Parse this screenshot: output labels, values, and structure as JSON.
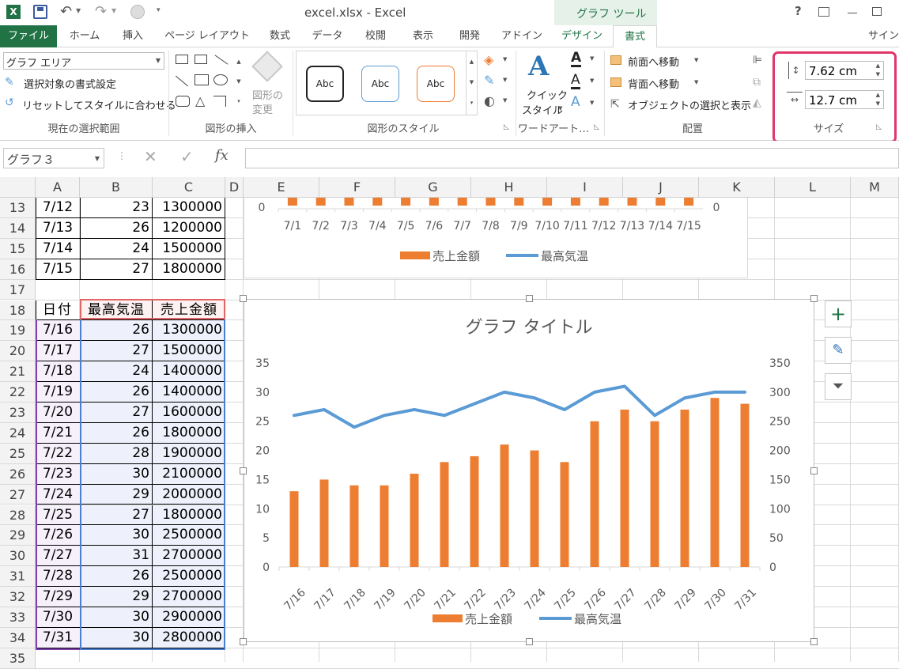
{
  "title_bar": {
    "doc_title": "excel.xlsx - Excel",
    "context_tool": "グラフ ツール",
    "help": "?",
    "colors": {
      "excel_green": "#217346",
      "accent_red": "#e0366a"
    }
  },
  "tabs": {
    "file": "ファイル",
    "home": "ホーム",
    "insert": "挿入",
    "layout": "ページ レイアウト",
    "formulas": "数式",
    "data": "データ",
    "review": "校閲",
    "view": "表示",
    "developer": "開発",
    "addins": "アドイン",
    "design": "デザイン",
    "format": "書式",
    "signin": "サイン"
  },
  "ribbon": {
    "selection": {
      "dropdown_value": "グラフ エリア",
      "format_selection": "選択対象の書式設定",
      "reset_style": "リセットしてスタイルに合わせる",
      "label": "現在の選択範囲"
    },
    "insert_shapes": {
      "change_shape_1": "図形の",
      "change_shape_2": "変更",
      "label": "図形の挿入"
    },
    "shape_styles": {
      "abc": "Abc",
      "label": "図形のスタイル"
    },
    "wordart": {
      "quick_1": "クイック",
      "quick_2": "スタイル",
      "label": "ワードアート…"
    },
    "arrange": {
      "bring_forward": "前面へ移動",
      "send_backward": "背面へ移動",
      "selection_pane": "オブジェクトの選択と表示",
      "label": "配置"
    },
    "size": {
      "height": "7.62 cm",
      "width": "12.7 cm",
      "label": "サイズ"
    }
  },
  "formula_bar": {
    "name_box": "グラフ３",
    "fx": "fx"
  },
  "columns": [
    "A",
    "B",
    "C",
    "D",
    "E",
    "F",
    "G",
    "H",
    "I",
    "J",
    "K",
    "L",
    "M"
  ],
  "rows": [
    {
      "n": "13",
      "a": "7/12",
      "b": "23",
      "c": "1300000"
    },
    {
      "n": "14",
      "a": "7/13",
      "b": "26",
      "c": "1200000"
    },
    {
      "n": "15",
      "a": "7/14",
      "b": "24",
      "c": "1500000"
    },
    {
      "n": "16",
      "a": "7/15",
      "b": "27",
      "c": "1800000"
    },
    {
      "n": "17",
      "a": "",
      "b": "",
      "c": ""
    },
    {
      "n": "18",
      "a": "日付",
      "b": "最高気温",
      "c": "売上金額"
    },
    {
      "n": "19",
      "a": "7/16",
      "b": "26",
      "c": "1300000"
    },
    {
      "n": "20",
      "a": "7/17",
      "b": "27",
      "c": "1500000"
    },
    {
      "n": "21",
      "a": "7/18",
      "b": "24",
      "c": "1400000"
    },
    {
      "n": "22",
      "a": "7/19",
      "b": "26",
      "c": "1400000"
    },
    {
      "n": "23",
      "a": "7/20",
      "b": "27",
      "c": "1600000"
    },
    {
      "n": "24",
      "a": "7/21",
      "b": "26",
      "c": "1800000"
    },
    {
      "n": "25",
      "a": "7/22",
      "b": "28",
      "c": "1900000"
    },
    {
      "n": "26",
      "a": "7/23",
      "b": "30",
      "c": "2100000"
    },
    {
      "n": "27",
      "a": "7/24",
      "b": "29",
      "c": "2000000"
    },
    {
      "n": "28",
      "a": "7/25",
      "b": "27",
      "c": "1800000"
    },
    {
      "n": "29",
      "a": "7/26",
      "b": "30",
      "c": "2500000"
    },
    {
      "n": "30",
      "a": "7/27",
      "b": "31",
      "c": "2700000"
    },
    {
      "n": "31",
      "a": "7/28",
      "b": "26",
      "c": "2500000"
    },
    {
      "n": "32",
      "a": "7/29",
      "b": "29",
      "c": "2700000"
    },
    {
      "n": "33",
      "a": "7/30",
      "b": "30",
      "c": "2900000"
    },
    {
      "n": "34",
      "a": "7/31",
      "b": "30",
      "c": "2800000"
    },
    {
      "n": "35",
      "a": "",
      "b": "",
      "c": ""
    }
  ],
  "chart_data": [
    {
      "type": "bar",
      "categories": [
        "7/1",
        "7/2",
        "7/3",
        "7/4",
        "7/5",
        "7/6",
        "7/7",
        "7/8",
        "7/9",
        "7/10",
        "7/11",
        "7/12",
        "7/13",
        "7/14",
        "7/15"
      ],
      "visible_tick_left": "0",
      "visible_tick_right": "0",
      "legend": [
        "売上金額",
        "最高気温"
      ],
      "colors": {
        "bar": "#ed7d31",
        "line": "#5b9bd5"
      }
    },
    {
      "type": "bar",
      "title": "グラフ タイトル",
      "categories": [
        "7/16",
        "7/17",
        "7/18",
        "7/19",
        "7/20",
        "7/21",
        "7/22",
        "7/23",
        "7/24",
        "7/25",
        "7/26",
        "7/27",
        "7/28",
        "7/29",
        "7/30",
        "7/31"
      ],
      "series": [
        {
          "name": "売上金額",
          "type": "bar",
          "axis": "left",
          "values": [
            13,
            15,
            14,
            14,
            16,
            18,
            19,
            21,
            20,
            18,
            25,
            27,
            25,
            27,
            29,
            28
          ]
        },
        {
          "name": "最高気温",
          "type": "line",
          "axis": "right",
          "values": [
            260,
            270,
            240,
            260,
            270,
            260,
            280,
            300,
            290,
            270,
            300,
            310,
            260,
            290,
            300,
            300
          ]
        }
      ],
      "ylim": [
        0,
        35
      ],
      "yticks": [
        "0",
        "5",
        "10",
        "15",
        "20",
        "25",
        "30",
        "35"
      ],
      "y2lim": [
        0,
        350
      ],
      "y2ticks": [
        "0",
        "50",
        "100",
        "150",
        "200",
        "250",
        "300",
        "350"
      ],
      "legend": [
        "売上金額",
        "最高気温"
      ],
      "legend_position": "bottom",
      "grid": false,
      "colors": {
        "bar": "#ed7d31",
        "line": "#5b9bd5"
      }
    }
  ]
}
